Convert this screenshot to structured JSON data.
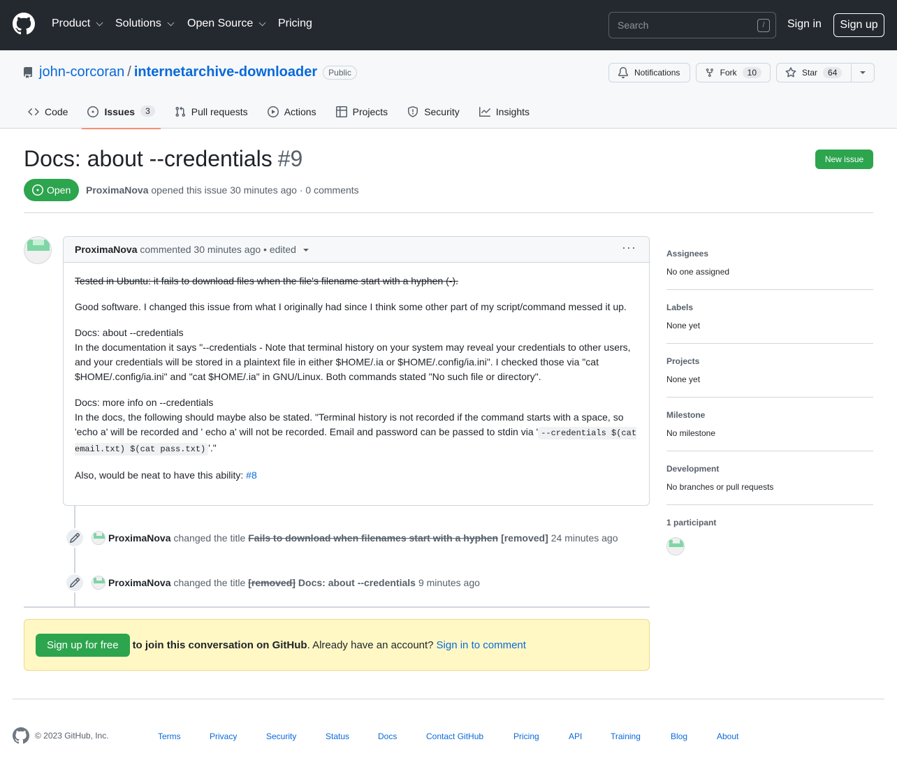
{
  "header": {
    "nav": [
      "Product",
      "Solutions",
      "Open Source",
      "Pricing"
    ],
    "search_placeholder": "Search",
    "search_shortcut": "/",
    "sign_in": "Sign in",
    "sign_up": "Sign up"
  },
  "repo": {
    "owner": "john-corcoran",
    "separator": "/",
    "name": "internetarchive-downloader",
    "visibility": "Public",
    "notifications_label": "Notifications",
    "fork_label": "Fork",
    "fork_count": "10",
    "star_label": "Star",
    "star_count": "64"
  },
  "tabs": [
    {
      "label": "Code"
    },
    {
      "label": "Issues",
      "count": "3"
    },
    {
      "label": "Pull requests"
    },
    {
      "label": "Actions"
    },
    {
      "label": "Projects"
    },
    {
      "label": "Security"
    },
    {
      "label": "Insights"
    }
  ],
  "issue": {
    "title": "Docs: about --credentials",
    "number": "#9",
    "new_issue_label": "New issue",
    "state": "Open",
    "author": "ProximaNova",
    "opened_text": "opened this issue 30 minutes ago · 0 comments"
  },
  "comment": {
    "author": "ProximaNova",
    "meta": "commented 30 minutes ago • edited",
    "struck": "Tested in Ubuntu: it fails to download files when the file's filename start with a hyphen (-).",
    "p1": "Good software. I changed this issue from what I originally had since I think some other part of my script/command messed it up.",
    "p2_heading": "Docs: about --credentials",
    "p2_body": "In the documentation it says \"--credentials - Note that terminal history on your system may reveal your credentials to other users, and your credentials will be stored in a plaintext file in either $HOME/.ia or $HOME/.config/ia.ini\". I checked those via \"cat $HOME/.config/ia.ini\" and \"cat $HOME/.ia\" in GNU/Linux. Both commands stated \"No such file or directory\".",
    "p3_heading": "Docs: more info on --credentials",
    "p3_body": "In the docs, the following should maybe also be stated. \"Terminal history is not recorded if the command starts with a space, so 'echo a' will be recorded and ' echo a' will not be recorded. Email and password can be passed to stdin via '",
    "p3_code": "--credentials $(cat email.txt) $(cat pass.txt)",
    "p3_end": "'.\"",
    "p4_text": "Also, would be neat to have this ability:",
    "p4_link": "#8"
  },
  "timeline": [
    {
      "author": "ProximaNova",
      "action": "changed the title",
      "old_title": "Fails to download when filenames start with a hyphen",
      "new_title": "[removed]",
      "time": "24 minutes ago"
    },
    {
      "author": "ProximaNova",
      "action": "changed the title",
      "old_title": "[removed]",
      "new_title": "Docs: about --credentials",
      "time": "9 minutes ago"
    }
  ],
  "join": {
    "button": "Sign up for free",
    "bold": "to join this conversation on GitHub",
    "text": ". Already have an account?",
    "link": "Sign in to comment"
  },
  "sidebar": [
    {
      "label": "Assignees",
      "value": "No one assigned"
    },
    {
      "label": "Labels",
      "value": "None yet"
    },
    {
      "label": "Projects",
      "value": "None yet"
    },
    {
      "label": "Milestone",
      "value": "No milestone"
    },
    {
      "label": "Development",
      "value": "No branches or pull requests"
    },
    {
      "label": "1 participant",
      "value": ""
    }
  ],
  "footer": {
    "copyright": "© 2023 GitHub, Inc.",
    "links": [
      "Terms",
      "Privacy",
      "Security",
      "Status",
      "Docs",
      "Contact GitHub",
      "Pricing",
      "API",
      "Training",
      "Blog",
      "About"
    ]
  },
  "colors": {
    "header_bg": "#24292f",
    "accent_green": "#2da44e",
    "link_blue": "#0969da",
    "tab_underline": "#fd8c73",
    "join_bg": "#fff8c5"
  },
  "icons": [
    "github-logo-icon",
    "repo-icon",
    "bell-icon",
    "fork-icon",
    "star-icon",
    "code-icon",
    "issue-icon",
    "pull-request-icon",
    "play-icon",
    "table-icon",
    "shield-icon",
    "graph-icon",
    "pencil-icon",
    "kebab-icon",
    "caret-down-icon"
  ]
}
